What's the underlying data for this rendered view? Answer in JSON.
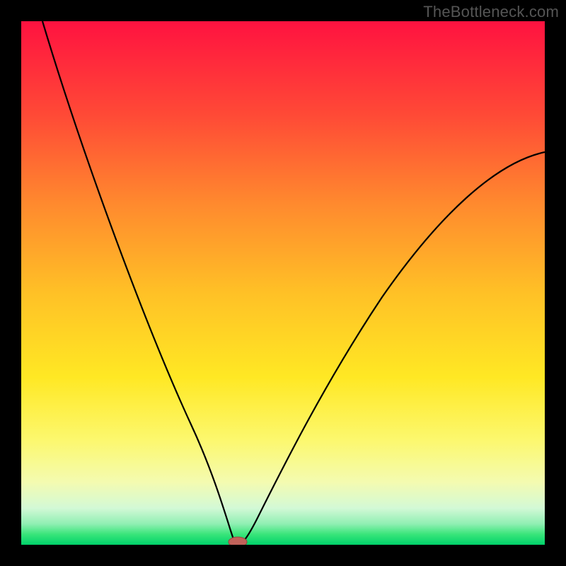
{
  "watermark": "TheBottleneck.com",
  "chart_data": {
    "type": "line",
    "title": "",
    "xlabel": "",
    "ylabel": "",
    "xlim": [
      0,
      100
    ],
    "ylim": [
      0,
      100
    ],
    "background_gradient_colors_top_to_bottom": [
      "#ff1240",
      "#ff6e32",
      "#ffb82a",
      "#ffe824",
      "#fcf86e",
      "#f4fbb0",
      "#d3f9d6",
      "#39e57a",
      "#00d26a"
    ],
    "curve_points": [
      {
        "x": 4,
        "y": 100
      },
      {
        "x": 10,
        "y": 80
      },
      {
        "x": 18,
        "y": 55
      },
      {
        "x": 25,
        "y": 35
      },
      {
        "x": 30,
        "y": 22
      },
      {
        "x": 34,
        "y": 12
      },
      {
        "x": 37,
        "y": 6
      },
      {
        "x": 39,
        "y": 2
      },
      {
        "x": 40.5,
        "y": 0
      },
      {
        "x": 42,
        "y": 0
      },
      {
        "x": 44,
        "y": 3
      },
      {
        "x": 48,
        "y": 10
      },
      {
        "x": 55,
        "y": 24
      },
      {
        "x": 65,
        "y": 42
      },
      {
        "x": 78,
        "y": 58
      },
      {
        "x": 90,
        "y": 68
      },
      {
        "x": 100,
        "y": 75
      }
    ],
    "minimum_marker": {
      "x": 41,
      "y": 0,
      "color": "#c1625a"
    },
    "annotations": []
  }
}
